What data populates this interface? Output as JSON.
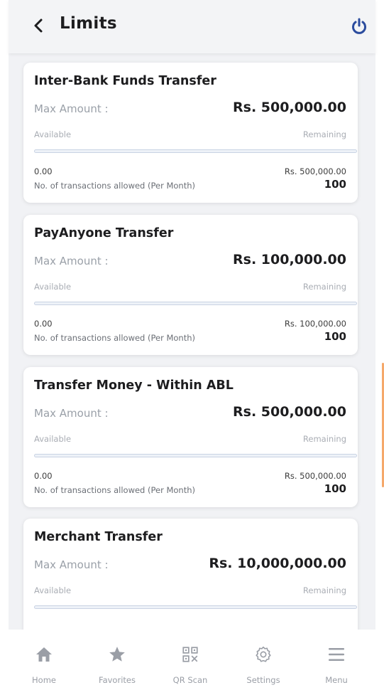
{
  "header": {
    "title": "Limits",
    "back_icon": "chevron-left-icon",
    "power_icon": "power-icon",
    "accent_color": "#2b4c9e"
  },
  "cards": [
    {
      "title": "Inter-Bank Funds Transfer",
      "max_label": "Max Amount :",
      "max_value": "Rs. 500,000.00",
      "available_label": "Available",
      "remaining_label": "Remaining",
      "used_value": "0.00",
      "remaining_value": "Rs. 500,000.00",
      "progress_fraction": 0,
      "tx_label": "No. of transactions allowed (Per Month)",
      "tx_value": "100"
    },
    {
      "title": "PayAnyone Transfer",
      "max_label": "Max Amount :",
      "max_value": "Rs. 100,000.00",
      "available_label": "Available",
      "remaining_label": "Remaining",
      "used_value": "0.00",
      "remaining_value": "Rs. 100,000.00",
      "progress_fraction": 0,
      "tx_label": "No. of transactions allowed (Per Month)",
      "tx_value": "100"
    },
    {
      "title": "Transfer Money - Within ABL",
      "max_label": "Max Amount :",
      "max_value": "Rs. 500,000.00",
      "available_label": "Available",
      "remaining_label": "Remaining",
      "used_value": "0.00",
      "remaining_value": "Rs. 500,000.00",
      "progress_fraction": 0,
      "tx_label": "No. of transactions allowed (Per Month)",
      "tx_value": "100"
    },
    {
      "title": "Merchant Transfer",
      "max_label": "Max Amount :",
      "max_value": "Rs. 10,000,000.00",
      "available_label": "Available",
      "remaining_label": "Remaining",
      "used_value": "",
      "remaining_value": "",
      "progress_fraction": 0,
      "tx_label": "",
      "tx_value": ""
    }
  ],
  "nav": {
    "items": [
      {
        "label": "Home",
        "icon": "home-icon"
      },
      {
        "label": "Favorites",
        "icon": "star-icon"
      },
      {
        "label": "QR Scan",
        "icon": "qr-code-icon"
      },
      {
        "label": "Settings",
        "icon": "gear-icon"
      },
      {
        "label": "Menu",
        "icon": "hamburger-menu-icon"
      }
    ]
  }
}
